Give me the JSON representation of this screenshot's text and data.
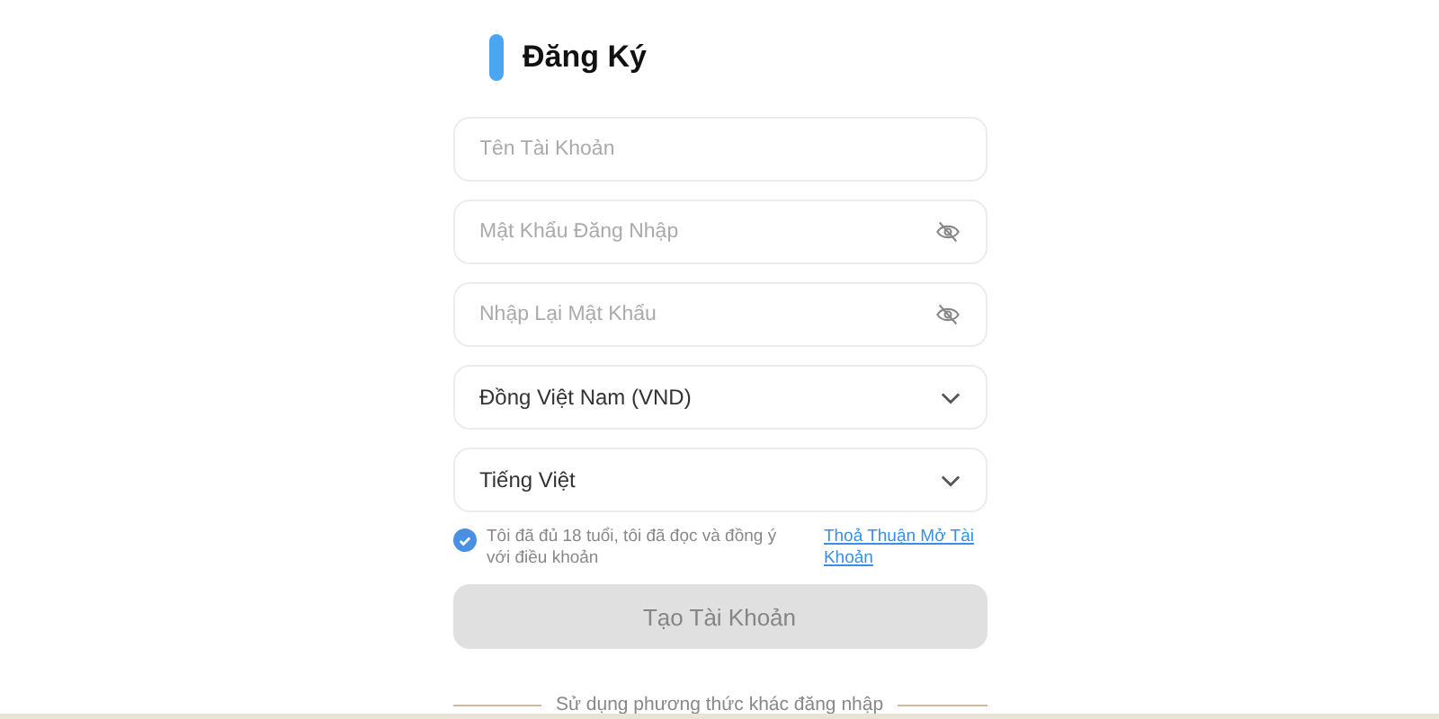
{
  "title": "Đăng Ký",
  "fields": [
    {
      "kind": "text",
      "placeholder": "Tên Tài Khoản"
    },
    {
      "kind": "password",
      "placeholder": "Mật Khẩu Đăng Nhập"
    },
    {
      "kind": "password",
      "placeholder": "Nhập Lại Mật Khẩu"
    },
    {
      "kind": "select",
      "value": "Đồng Việt Nam (VND)"
    },
    {
      "kind": "select",
      "value": "Tiếng Việt"
    }
  ],
  "agreement": {
    "checked": true,
    "text": "Tôi đã đủ 18 tuổi, tôi đã đọc và đồng ý với điều khoản",
    "link": "Thoả Thuận Mở Tài Khoản"
  },
  "submit": {
    "label": "Tạo Tài Khoản",
    "disabled": true
  },
  "alternative": "Sử dụng phương thức khác đăng nhập"
}
